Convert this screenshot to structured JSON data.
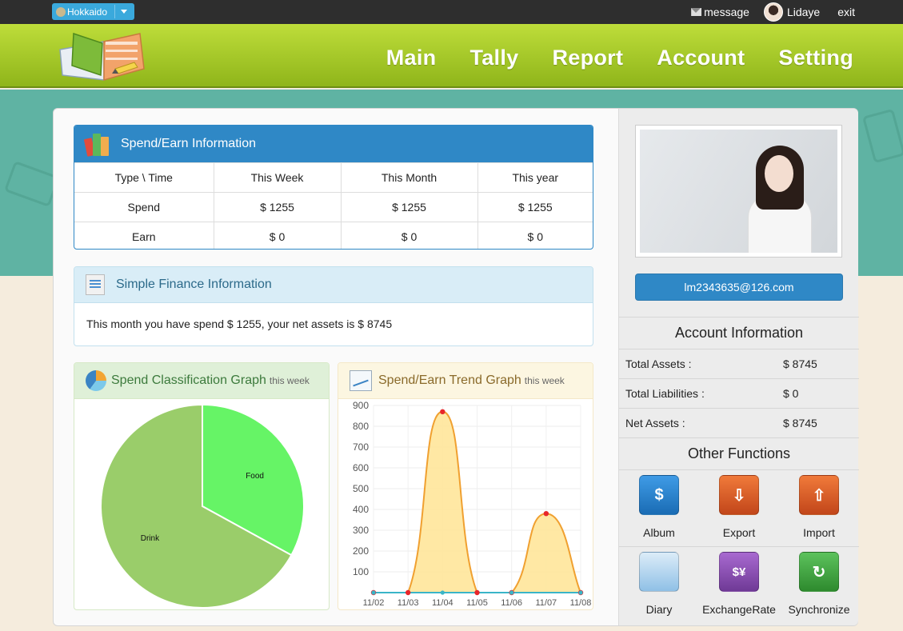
{
  "topbar": {
    "city": "Hokkaido",
    "message": "message",
    "username": "Lidaye",
    "exit": "exit"
  },
  "nav": {
    "items": [
      "Main",
      "Tally",
      "Report",
      "Account",
      "Setting"
    ]
  },
  "spend_earn": {
    "title": "Spend/Earn Information",
    "headers": [
      "Type \\ Time",
      "This Week",
      "This Month",
      "This year"
    ],
    "rows": [
      [
        "Spend",
        "$ 1255",
        "$ 1255",
        "$ 1255"
      ],
      [
        "Earn",
        "$ 0",
        "$ 0",
        "$ 0"
      ]
    ]
  },
  "simple_finance": {
    "title": "Simple Finance Information",
    "text": "This month you have spend $ 1255, your net assets is $ 8745"
  },
  "pie_panel": {
    "title": "Spend Classification Graph",
    "subtitle": "this week"
  },
  "trend_panel": {
    "title": "Spend/Earn Trend Graph",
    "subtitle": "this week"
  },
  "chart_data": [
    {
      "type": "pie",
      "categories": [
        "Food",
        "Drink"
      ],
      "values": [
        33,
        67
      ],
      "colors": [
        "#66f466",
        "#9acd6a"
      ]
    },
    {
      "type": "area",
      "categories": [
        "11/02",
        "11/03",
        "11/04",
        "11/05",
        "11/06",
        "11/07",
        "11/08"
      ],
      "ylim": [
        0,
        900
      ],
      "yticks": [
        100,
        200,
        300,
        400,
        500,
        600,
        700,
        800,
        900
      ],
      "series": [
        {
          "values": [
            0,
            0,
            870,
            0,
            0,
            380,
            0
          ],
          "color": "#f0a030",
          "fill": "#ffe59a"
        },
        {
          "values": [
            0,
            0,
            0,
            0,
            0,
            0,
            0
          ],
          "color": "#39b5c8"
        }
      ],
      "grid": true
    }
  ],
  "sidebar": {
    "email": "lm2343635@126.com",
    "account_title": "Account Information",
    "account": [
      {
        "label": "Total Assets :",
        "value": "$ 8745"
      },
      {
        "label": "Total Liabilities :",
        "value": "$ 0"
      },
      {
        "label": "Net Assets :",
        "value": "$ 8745"
      }
    ],
    "functions_title": "Other Functions",
    "functions": [
      {
        "label": "Album",
        "icon": "album-icon",
        "color": "#1f7fd0"
      },
      {
        "label": "Export",
        "icon": "export-icon",
        "color": "#d9541e"
      },
      {
        "label": "Import",
        "icon": "import-icon",
        "color": "#d9541e"
      },
      {
        "label": "Diary",
        "icon": "diary-icon",
        "color": "#7fb3e0"
      },
      {
        "label": "ExchangeRate",
        "icon": "exchange-rate-icon",
        "color": "#8a4fb0"
      },
      {
        "label": "Synchronize",
        "icon": "synchronize-icon",
        "color": "#3f9e3f"
      }
    ]
  }
}
